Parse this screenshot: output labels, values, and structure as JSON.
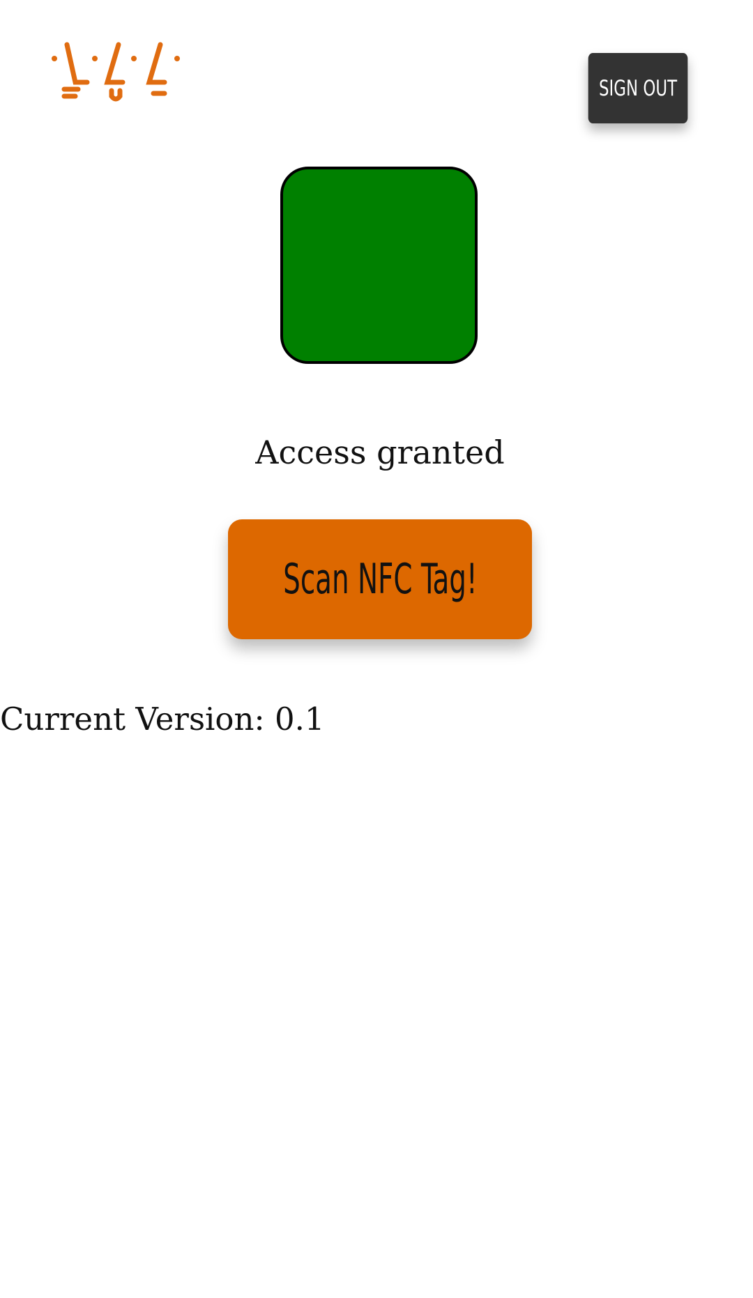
{
  "header": {
    "logo_icon": "lightbulbs-logo-icon",
    "sign_out_label": "SIGN OUT"
  },
  "status": {
    "indicator_color": "#008000",
    "message": "Access granted"
  },
  "scan": {
    "button_label": "Scan NFC Tag!",
    "button_color": "#dd6800"
  },
  "footer": {
    "version_text": "Current Version: 0.1"
  }
}
